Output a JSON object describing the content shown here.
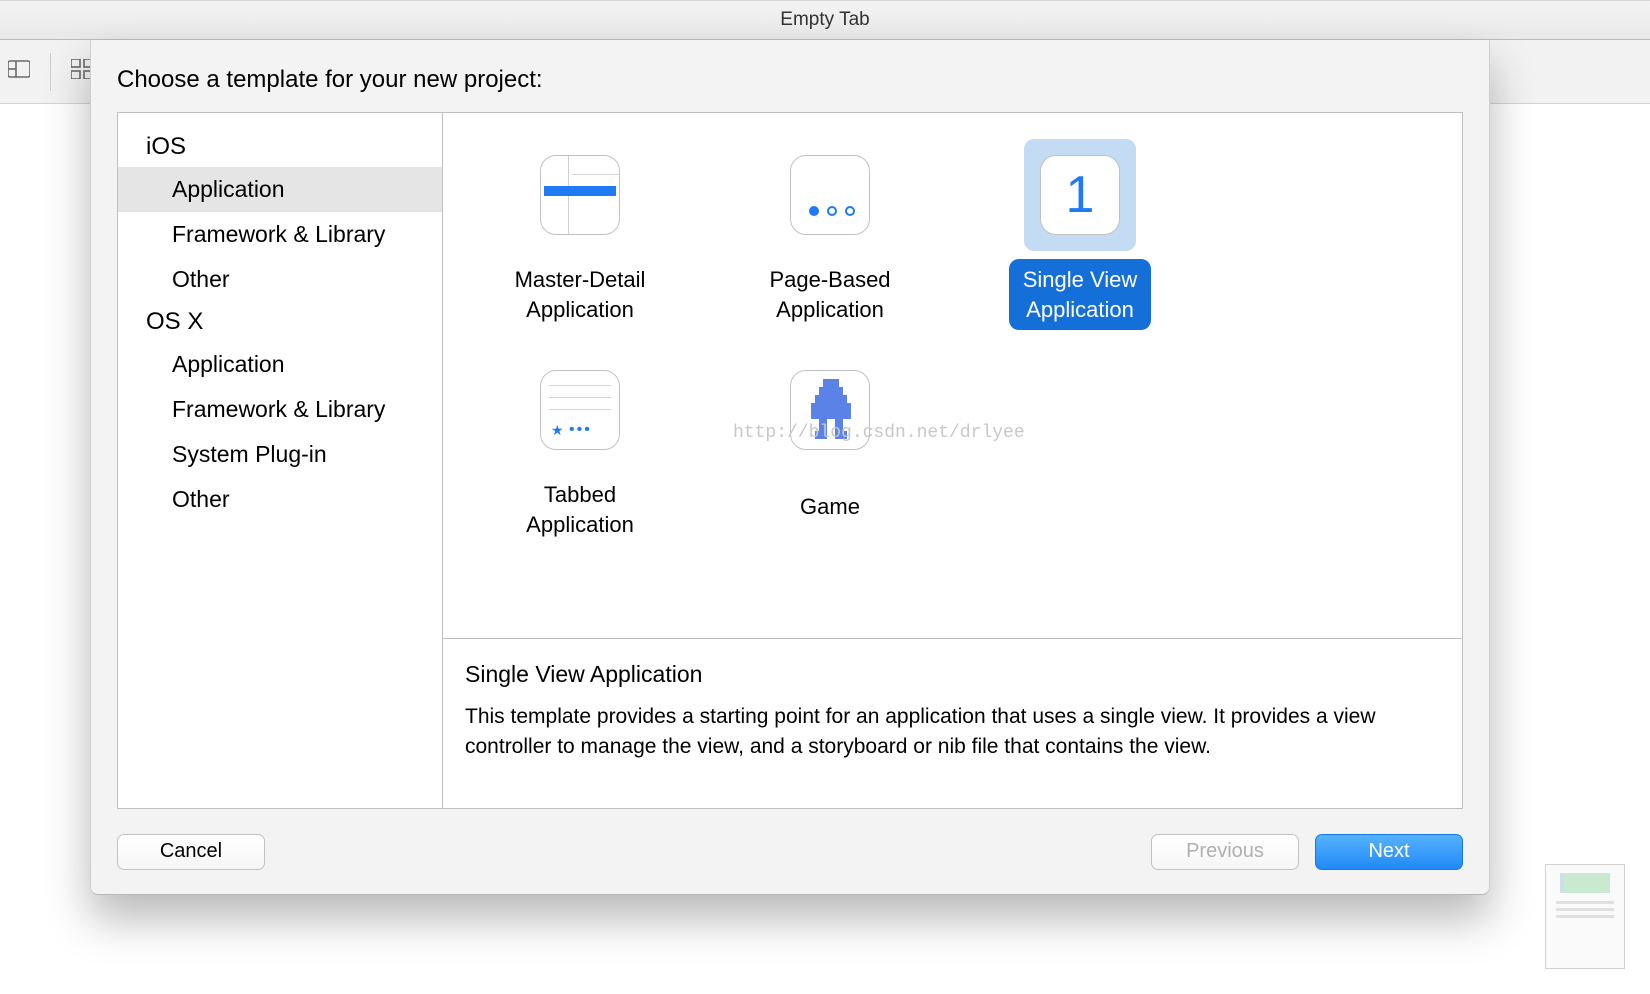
{
  "window": {
    "title": "Empty Tab"
  },
  "dialog": {
    "heading": "Choose a template for your new project:",
    "footer": {
      "cancel": "Cancel",
      "previous": "Previous",
      "next": "Next"
    }
  },
  "sidebar": {
    "groups": [
      {
        "header": "iOS",
        "items": [
          {
            "label": "Application",
            "selected": true
          },
          {
            "label": "Framework & Library"
          },
          {
            "label": "Other"
          }
        ]
      },
      {
        "header": "OS X",
        "items": [
          {
            "label": "Application"
          },
          {
            "label": "Framework & Library"
          },
          {
            "label": "System Plug-in"
          },
          {
            "label": "Other"
          }
        ]
      }
    ]
  },
  "templates": [
    {
      "id": "master-detail",
      "label": "Master-Detail\nApplication"
    },
    {
      "id": "page-based",
      "label": "Page-Based\nApplication"
    },
    {
      "id": "single-view",
      "label": "Single View\nApplication",
      "selected": true
    },
    {
      "id": "tabbed",
      "label": "Tabbed\nApplication"
    },
    {
      "id": "game",
      "label": "Game"
    }
  ],
  "description": {
    "title": "Single View Application",
    "body": "This template provides a starting point for an application that uses a single view. It provides a view controller to manage the view, and a storyboard or nib file that contains the view."
  },
  "watermark": "http://blog.csdn.net/drlyee"
}
